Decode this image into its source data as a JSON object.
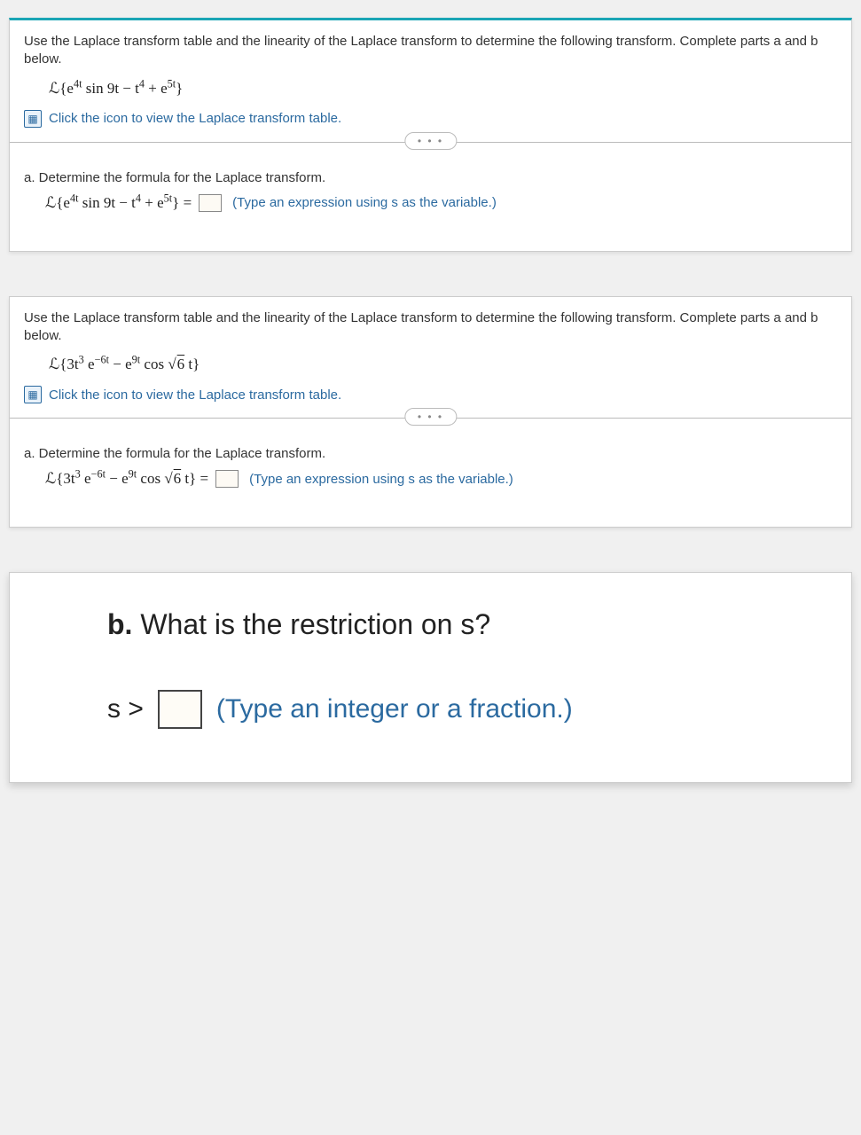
{
  "problem1": {
    "instruction": "Use the Laplace transform table and the linearity of the Laplace transform to determine the following transform. Complete parts a and b below.",
    "formula_html": "ℒ{e<sup>4t</sup> sin 9t − t<sup>4</sup> + e<sup>5t</sup>}",
    "link_text": "Click the icon to view the Laplace transform table.",
    "dots": "• • •",
    "part_a_label": "a. Determine the formula for the Laplace transform.",
    "answer_formula_html": "ℒ{e<sup>4t</sup> sin 9t − t<sup>4</sup> + e<sup>5t</sup>} = ",
    "hint": "(Type an expression using s as the variable.)"
  },
  "problem2": {
    "instruction": "Use the Laplace transform table and the linearity of the Laplace transform to determine the following transform. Complete parts a and b below.",
    "formula_html": "ℒ{3t<sup>3</sup> e<sup>−6t</sup> − e<sup>9t</sup> cos √<span class='sqrt'>6</span> t}",
    "link_text": "Click the icon to view the Laplace transform table.",
    "dots": "• • •",
    "part_a_label": "a. Determine the formula for the Laplace transform.",
    "answer_formula_html": "ℒ{3t<sup>3</sup> e<sup>−6t</sup> − e<sup>9t</sup> cos √<span class='sqrt'>6</span> t} = ",
    "hint": "(Type an expression using s as the variable.)"
  },
  "part_b": {
    "question_html": "<b>b.</b> What is the restriction on s?",
    "prefix": "s >",
    "hint": "(Type an integer or a fraction.)"
  }
}
